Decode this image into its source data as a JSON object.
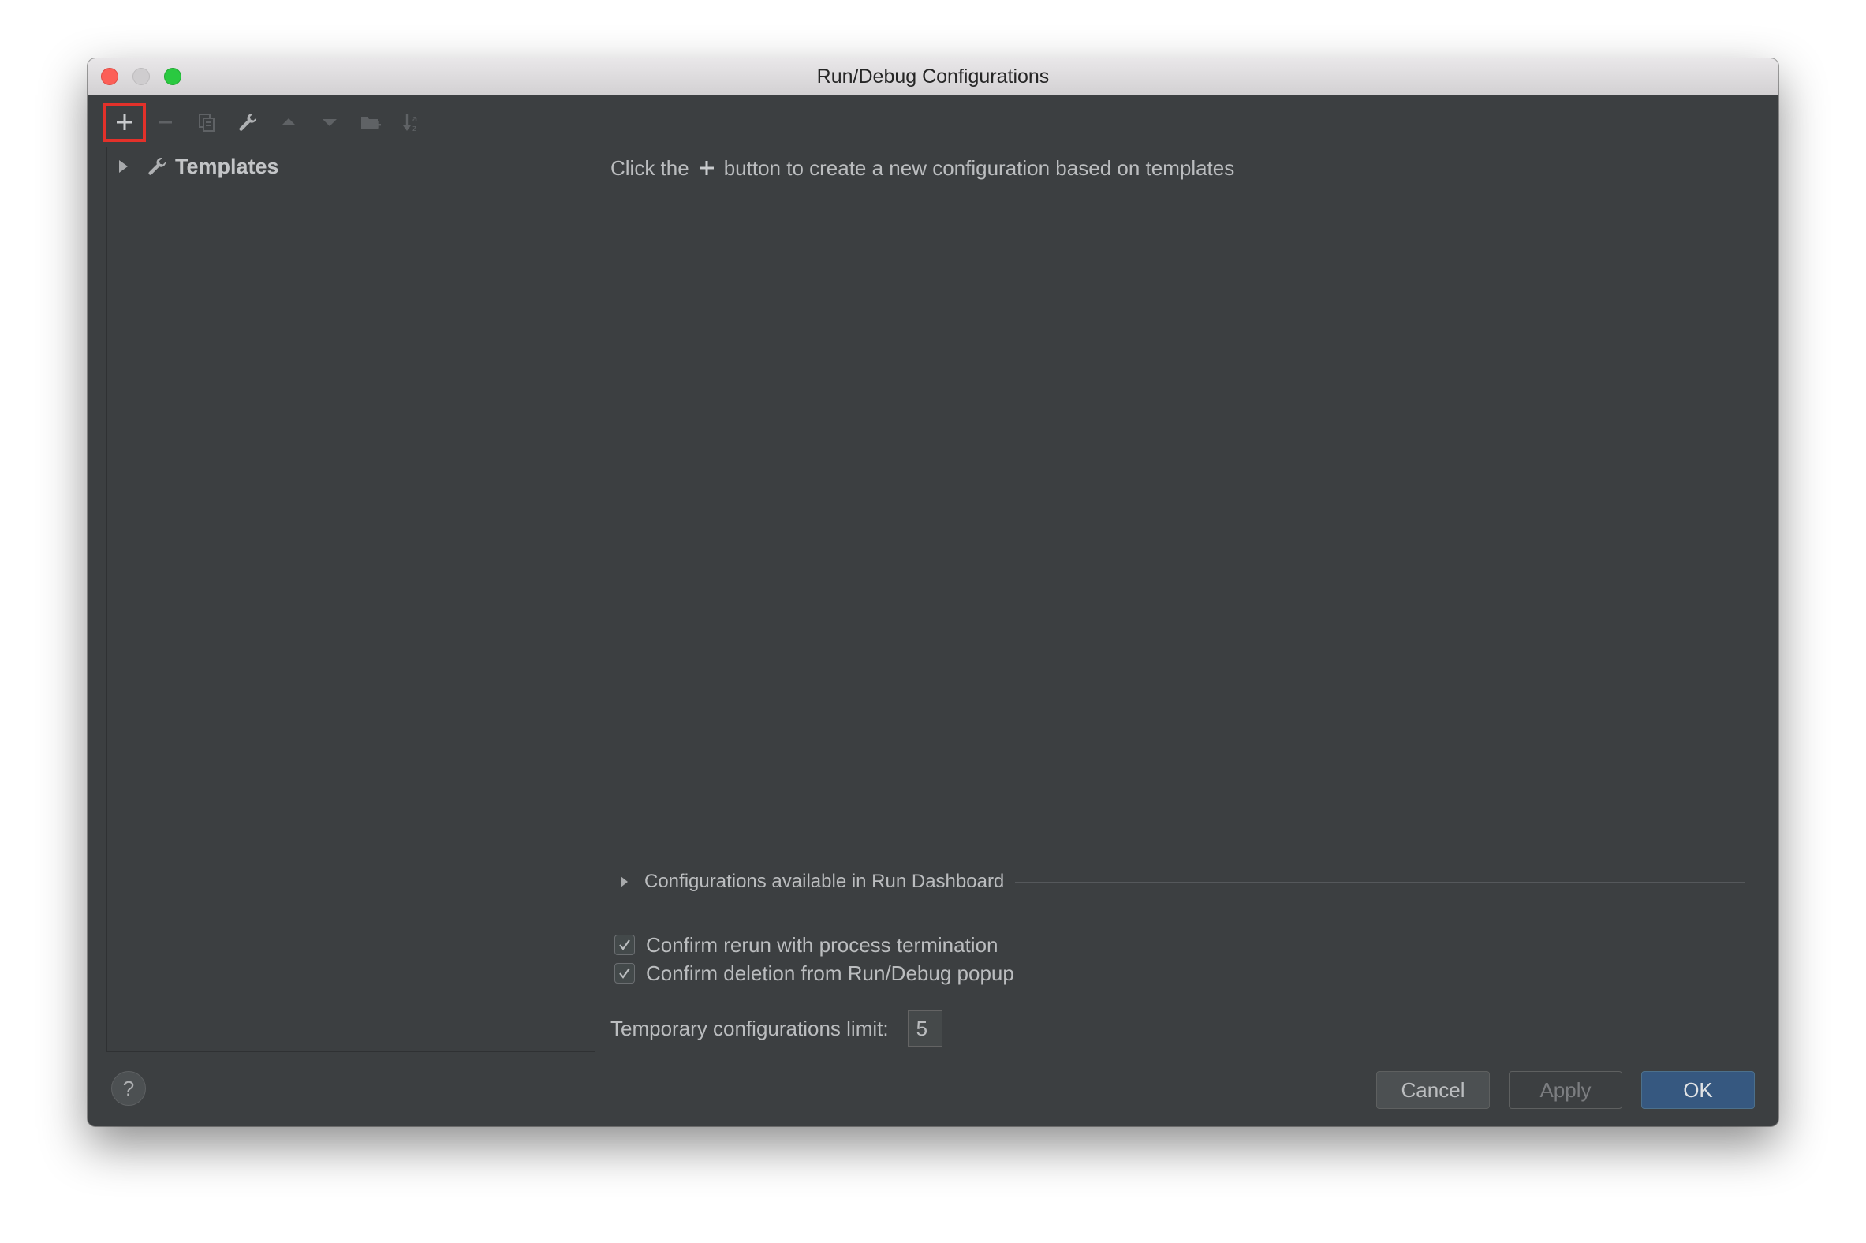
{
  "window": {
    "title": "Run/Debug Configurations"
  },
  "toolbar": {
    "buttons": [
      {
        "name": "add",
        "icon": "plus-icon",
        "enabled": true,
        "highlighted": true
      },
      {
        "name": "remove",
        "icon": "minus-icon",
        "enabled": false
      },
      {
        "name": "copy",
        "icon": "copy-icon",
        "enabled": false
      },
      {
        "name": "edit-templates",
        "icon": "wrench-icon",
        "enabled": true
      },
      {
        "name": "move-up",
        "icon": "arrow-up-icon",
        "enabled": false
      },
      {
        "name": "move-down",
        "icon": "arrow-down-icon",
        "enabled": false
      },
      {
        "name": "new-folder",
        "icon": "folder-add-icon",
        "enabled": false
      },
      {
        "name": "sort",
        "icon": "sort-alpha-icon",
        "enabled": false
      }
    ]
  },
  "tree": {
    "items": [
      {
        "label": "Templates",
        "icon": "wrench-icon",
        "expanded": false
      }
    ]
  },
  "main": {
    "hint_prefix": "Click the",
    "hint_suffix": "button to create a new configuration based on templates",
    "dashboard_section": "Configurations available in Run Dashboard",
    "checkboxes": [
      {
        "label": "Confirm rerun with process termination",
        "checked": true
      },
      {
        "label": "Confirm deletion from Run/Debug popup",
        "checked": true
      }
    ],
    "temp_limit_label": "Temporary configurations limit:",
    "temp_limit_value": "5"
  },
  "footer": {
    "help": "?",
    "cancel": "Cancel",
    "apply": "Apply",
    "ok": "OK"
  },
  "colors": {
    "background": "#3c3f41",
    "highlight": "#e3312a",
    "ok_button": "#365880",
    "text": "#bbbdbf"
  }
}
